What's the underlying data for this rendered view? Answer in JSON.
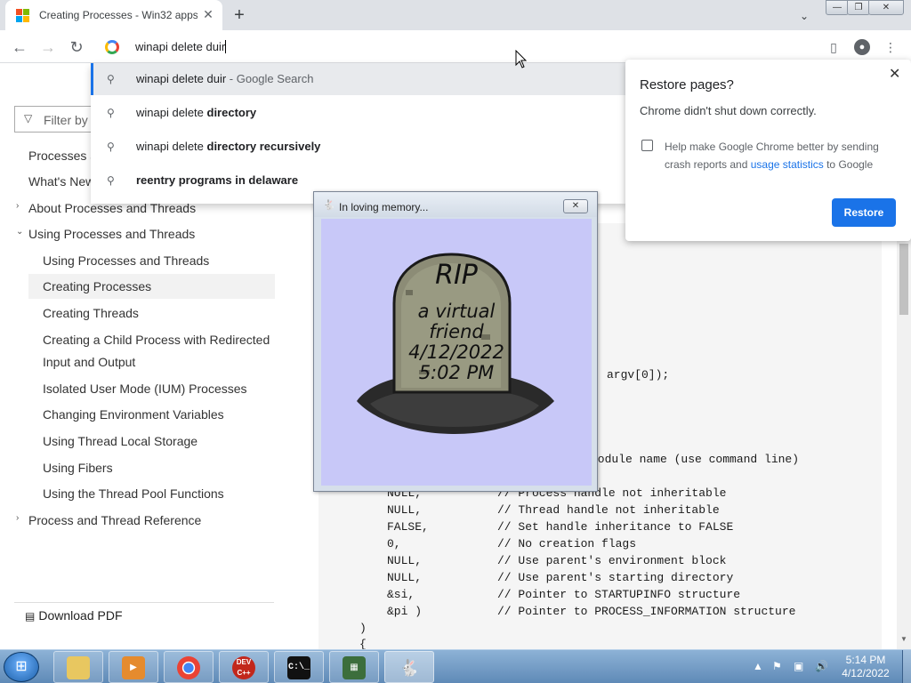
{
  "browser": {
    "tab": {
      "title": "Creating Processes - Win32 apps",
      "close": "✕"
    },
    "new_tab": "+",
    "tab_search": "⌄",
    "window_buttons": {
      "minimize": "—",
      "restore": "❐",
      "close": "✕"
    },
    "toolbar": {
      "back": "←",
      "forward": "→",
      "reload": "↻",
      "query": "winapi delete duir"
    }
  },
  "omnibox_suggestions": [
    {
      "prefix": "winapi delete duir",
      "bold": "",
      "suffix": " - Google Search"
    },
    {
      "prefix": "winapi delete ",
      "bold": "directory",
      "suffix": ""
    },
    {
      "prefix": "winapi delete ",
      "bold": "directory recursively",
      "suffix": ""
    },
    {
      "prefix": "",
      "bold": "reentry programs in delaware",
      "suffix": ""
    }
  ],
  "sidebar": {
    "filter_placeholder": "Filter by",
    "items": [
      "Processes a",
      "What's New",
      "About Processes and Threads",
      "Using Processes and Threads",
      "Using Processes and Threads",
      "Creating Processes",
      "Creating Threads",
      "Creating a Child Process with Redirected",
      "Input and Output",
      "Isolated User Mode (IUM) Processes",
      "Changing Environment Variables",
      "Using Thread Local Storage",
      "Using Fibers",
      "Using the Thread Pool Functions",
      "Process and Thread Reference"
    ],
    "download_pdf": "Download PDF"
  },
  "code": {
    "argv": "argv[0]);",
    "line_module": "module name (use command line)",
    "line_e": "e",
    "lines": [
      {
        "arg": "NULL,",
        "comment": "// Process handle not inheritable"
      },
      {
        "arg": "NULL,",
        "comment": "// Thread handle not inheritable"
      },
      {
        "arg": "FALSE,",
        "comment": "// Set handle inheritance to FALSE"
      },
      {
        "arg": "0,",
        "comment": "// No creation flags"
      },
      {
        "arg": "NULL,",
        "comment": "// Use parent's environment block"
      },
      {
        "arg": "NULL,",
        "comment": "// Use parent's starting directory"
      },
      {
        "arg": "&si,",
        "comment": "// Pointer to STARTUPINFO structure"
      },
      {
        "arg": "&pi )",
        "comment": "// Pointer to PROCESS_INFORMATION structure"
      }
    ],
    "close_paren": ")",
    "open_brace": "{"
  },
  "restore_bubble": {
    "title": "Restore pages?",
    "message": "Chrome didn't shut down correctly.",
    "checkbox_text_pre": "Help make Google Chrome better by sending crash reports and ",
    "checkbox_link": "usage statistics",
    "checkbox_text_post": " to Google",
    "button": "Restore",
    "close": "✕"
  },
  "memorial_window": {
    "title": "In loving memory...",
    "close": "✕",
    "tombstone": {
      "line1": "RIP",
      "line2": "a virtual",
      "line3": "friend",
      "line4": "4/12/2022",
      "line5": "5:02 PM"
    }
  },
  "taskbar": {
    "apps": [
      {
        "name": "explorer",
        "label": ""
      },
      {
        "name": "media-player",
        "label": ""
      },
      {
        "name": "chrome",
        "label": ""
      },
      {
        "name": "dev-cpp",
        "label": "DEV C++"
      },
      {
        "name": "cmd",
        "label": "C:\\_"
      },
      {
        "name": "monitor",
        "label": ""
      },
      {
        "name": "bunny",
        "label": ""
      }
    ],
    "clock": {
      "time": "5:14 PM",
      "date": "4/12/2022"
    }
  },
  "colors": {
    "accent": "#1a73e8",
    "memorial_bg": "#c8c8f8",
    "comment": "#008000"
  }
}
